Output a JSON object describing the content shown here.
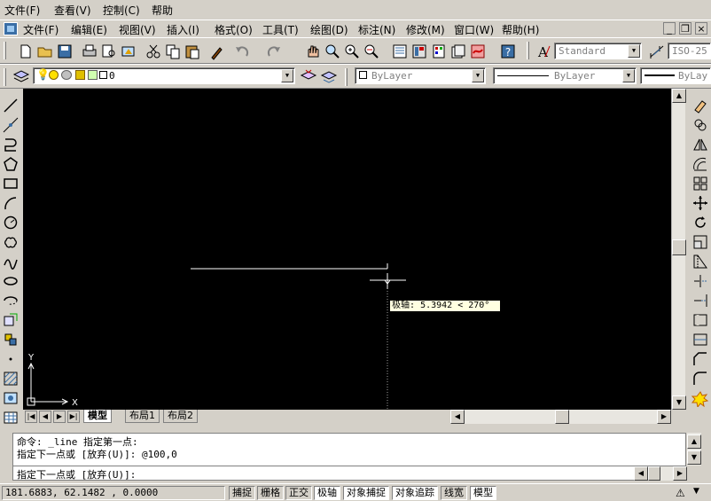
{
  "outer_menu": [
    "文件(F)",
    "查看(V)",
    "控制(C)",
    "帮助"
  ],
  "inner_menu": [
    "文件(F)",
    "编辑(E)",
    "视图(V)",
    "插入(I)",
    "格式(O)",
    "工具(T)",
    "绘图(D)",
    "标注(N)",
    "修改(M)",
    "窗口(W)",
    "帮助(H)"
  ],
  "window_buttons": {
    "minimize": "_",
    "restore": "❐",
    "close": "×"
  },
  "toolbar": {
    "text_style": "Standard",
    "dim_style": "ISO-25",
    "layer_name": "0",
    "color": "ByLayer",
    "linetype": "ByLayer",
    "lineweight": "ByLay"
  },
  "tooltip": {
    "label": "极轴:",
    "value": "5.3942 < 270°"
  },
  "ucs": {
    "x": "X",
    "y": "Y"
  },
  "tabs": [
    "模型",
    "布局1",
    "布局2"
  ],
  "tab_nav": [
    "|◀",
    "◀",
    "▶",
    "▶|"
  ],
  "command_lines": [
    "命令: _line 指定第一点:",
    "指定下一点或 [放弃(U)]: @100,0",
    "指定下一点或 [放弃(U)]:"
  ],
  "status": {
    "coordinates": "181.6883, 62.1482 , 0.0000",
    "toggles": [
      "捕捉",
      "栅格",
      "正交",
      "极轴",
      "对象捕捉",
      "对象追踪",
      "线宽",
      "模型"
    ]
  },
  "icons": {
    "left": [
      "line-icon",
      "construction-line-icon",
      "polyline-icon",
      "polygon-icon",
      "rectangle-icon",
      "arc-icon",
      "circle-icon",
      "revision-cloud-icon",
      "spline-icon",
      "ellipse-icon",
      "ellipse-arc-icon",
      "insert-block-icon",
      "make-block-icon",
      "point-icon",
      "hatch-icon",
      "region-icon",
      "table-icon"
    ],
    "right": [
      "erase-icon",
      "copy-icon",
      "mirror-icon",
      "offset-icon",
      "array-icon",
      "move-icon",
      "rotate-icon",
      "scale-icon",
      "stretch-icon",
      "trim-icon",
      "extend-icon",
      "break-icon",
      "join-icon",
      "chamfer-icon",
      "fillet-icon",
      "explode-icon"
    ]
  },
  "colors": {
    "canvas": "#000000",
    "entity": "#ffffff",
    "tooltip_bg": "#ffffe1",
    "chrome": "#d4d0c8"
  }
}
